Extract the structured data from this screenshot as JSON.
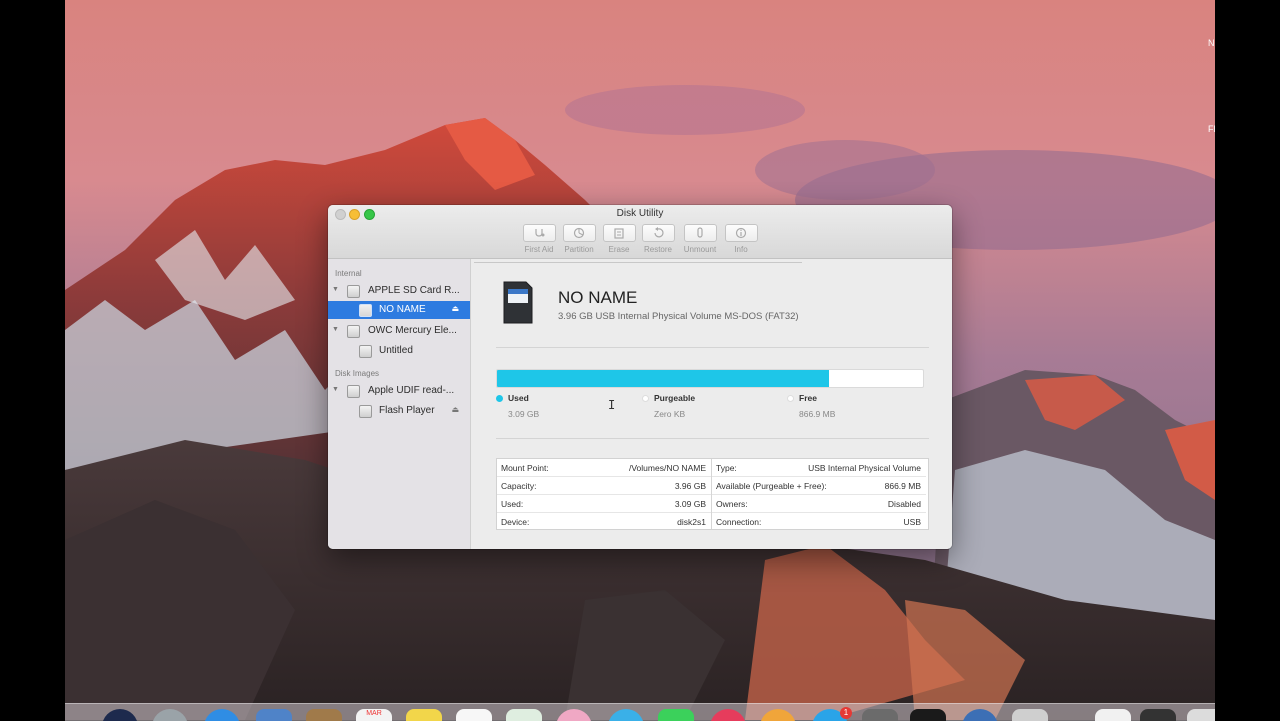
{
  "window": {
    "title": "Disk Utility"
  },
  "toolbar": {
    "first_aid": "First Aid",
    "partition": "Partition",
    "erase": "Erase",
    "restore": "Restore",
    "unmount": "Unmount",
    "info": "Info"
  },
  "sidebar": {
    "section_internal": "Internal",
    "section_disk_images": "Disk Images",
    "items": [
      {
        "label": "APPLE SD Card R...",
        "icon": "internal-disk-icon"
      },
      {
        "label": "NO NAME",
        "icon": "volume-icon",
        "selected": true
      },
      {
        "label": "OWC Mercury Ele...",
        "icon": "internal-disk-icon"
      },
      {
        "label": "Untitled",
        "icon": "volume-icon"
      },
      {
        "label": "Apple UDIF read-...",
        "icon": "disk-image-icon"
      },
      {
        "label": "Flash Player",
        "icon": "volume-icon"
      }
    ],
    "eject_glyph": "⏏"
  },
  "volume": {
    "name": "NO NAME",
    "subtitle": "3.96 GB USB Internal Physical Volume MS-DOS (FAT32)",
    "icon": "sd-card-icon"
  },
  "usage": {
    "used_fraction": 0.78,
    "used_label": "Used",
    "used_value": "3.09 GB",
    "used_color": "#1ec6e8",
    "purgeable_label": "Purgeable",
    "purgeable_value": "Zero KB",
    "free_label": "Free",
    "free_value": "866.9 MB"
  },
  "info": {
    "left": [
      {
        "key": "Mount Point:",
        "value": "/Volumes/NO NAME"
      },
      {
        "key": "Capacity:",
        "value": "3.96 GB"
      },
      {
        "key": "Used:",
        "value": "3.09 GB"
      },
      {
        "key": "Device:",
        "value": "disk2s1"
      }
    ],
    "right": [
      {
        "key": "Type:",
        "value": "USB Internal Physical Volume"
      },
      {
        "key": "Available (Purgeable + Free):",
        "value": "866.9 MB"
      },
      {
        "key": "Owners:",
        "value": "Disabled"
      },
      {
        "key": "Connection:",
        "value": "USB"
      }
    ]
  },
  "dock": {
    "calendar_month": "MAR",
    "badge_count": "1"
  }
}
